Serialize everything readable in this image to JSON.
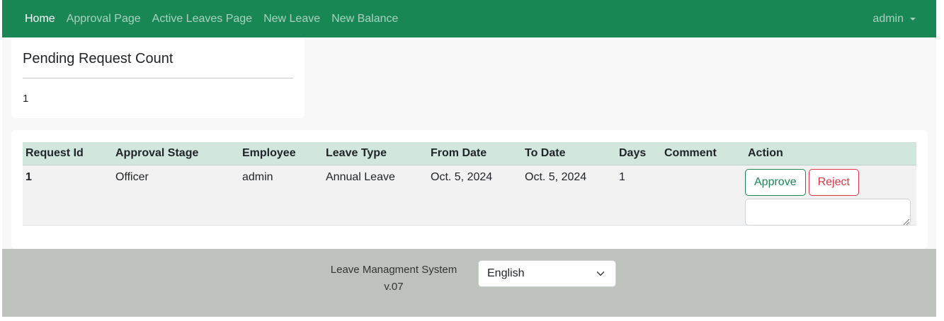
{
  "navbar": {
    "links": [
      {
        "label": "Home",
        "active": true
      },
      {
        "label": "Approval Page",
        "active": false
      },
      {
        "label": "Active Leaves Page",
        "active": false
      },
      {
        "label": "New Leave",
        "active": false
      },
      {
        "label": "New Balance",
        "active": false
      }
    ],
    "user": "admin"
  },
  "pending_card": {
    "title": "Pending Request Count",
    "value": "1"
  },
  "requests_table": {
    "columns": [
      "Request Id",
      "Approval Stage",
      "Employee",
      "Leave Type",
      "From Date",
      "To Date",
      "Days",
      "Comment",
      "Action"
    ],
    "rows": [
      {
        "request_id": "1",
        "approval_stage": "Officer",
        "employee": "admin",
        "leave_type": "Annual Leave",
        "from_date": "Oct. 5, 2024",
        "to_date": "Oct. 5, 2024",
        "days": "1",
        "comment": "",
        "approve_label": "Approve",
        "reject_label": "Reject",
        "comment_input_value": ""
      }
    ]
  },
  "footer": {
    "system_name": "Leave Managment System",
    "version": "v.07",
    "language_selected": "English"
  },
  "colors": {
    "brand": "#198754",
    "table_header": "#d1e7dd",
    "danger": "#dc3545",
    "footer_bg": "#bdc3bc"
  },
  "icons": {
    "user_dropdown": "caret-down-icon",
    "language_dropdown": "chevron-down-icon"
  }
}
